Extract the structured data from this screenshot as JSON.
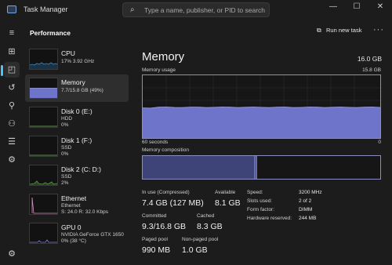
{
  "window": {
    "title": "Task Manager",
    "search_placeholder": "Type a name, publisher, or PID to search",
    "controls": {
      "minimize": "—",
      "maximize": "☐",
      "close": "✕"
    }
  },
  "header": {
    "title": "Performance",
    "run_task_label": "Run new task",
    "more_label": "···"
  },
  "rail": {
    "icons": [
      "hamburger-icon",
      "processes-icon",
      "performance-icon",
      "app-history-icon",
      "startup-apps-icon",
      "users-icon",
      "details-icon",
      "services-icon",
      "settings-icon"
    ]
  },
  "sidebar": {
    "items": [
      {
        "name": "CPU",
        "line1": "17% 3.92 GHz",
        "line2": ""
      },
      {
        "name": "Memory",
        "line1": "7.7/15.8 GB (49%)",
        "line2": ""
      },
      {
        "name": "Disk 0 (E:)",
        "line1": "HDD",
        "line2": "0%"
      },
      {
        "name": "Disk 1 (F:)",
        "line1": "SSD",
        "line2": "0%"
      },
      {
        "name": "Disk 2 (C: D:)",
        "line1": "SSD",
        "line2": "2%"
      },
      {
        "name": "Ethernet",
        "line1": "Ethernet",
        "line2": "S: 24.0  R: 32.0 Kbps"
      },
      {
        "name": "GPU 0",
        "line1": "NVIDIA GeForce GTX 1650",
        "line2": "0% (38 °C)"
      }
    ]
  },
  "memory": {
    "title": "Memory",
    "total": "16.0 GB",
    "usage_label": "Memory usage",
    "usage_max": "15.8 GB",
    "time_left": "60 seconds",
    "time_right": "0",
    "composition_label": "Memory composition",
    "usage_fraction": 0.49,
    "composition": {
      "in_use_fraction": 0.47,
      "modified_fraction": 0.01
    },
    "stats": {
      "in_use_label": "In use (Compressed)",
      "in_use_value": "7.4 GB (127 MB)",
      "available_label": "Available",
      "available_value": "8.1 GB",
      "committed_label": "Committed",
      "committed_value": "9.3/16.8 GB",
      "cached_label": "Cached",
      "cached_value": "8.3 GB",
      "paged_label": "Paged pool",
      "paged_value": "990 MB",
      "nonpaged_label": "Non-paged pool",
      "nonpaged_value": "1.0 GB"
    },
    "specs": [
      {
        "key": "Speed:",
        "value": "3200 MHz"
      },
      {
        "key": "Slots used:",
        "value": "2 of 2"
      },
      {
        "key": "Form factor:",
        "value": "DIMM"
      },
      {
        "key": "Hardware reserved:",
        "value": "244 MB"
      }
    ]
  },
  "colors": {
    "memory_fill": "#6e74c9",
    "memory_line": "#8b8fbf",
    "cpu_line": "#4ea5e0",
    "disk_line": "#6fbf58",
    "ethernet_line": "#d98fc0",
    "gpu_line": "#7f7fd0",
    "accent": "#4cc2ff"
  }
}
